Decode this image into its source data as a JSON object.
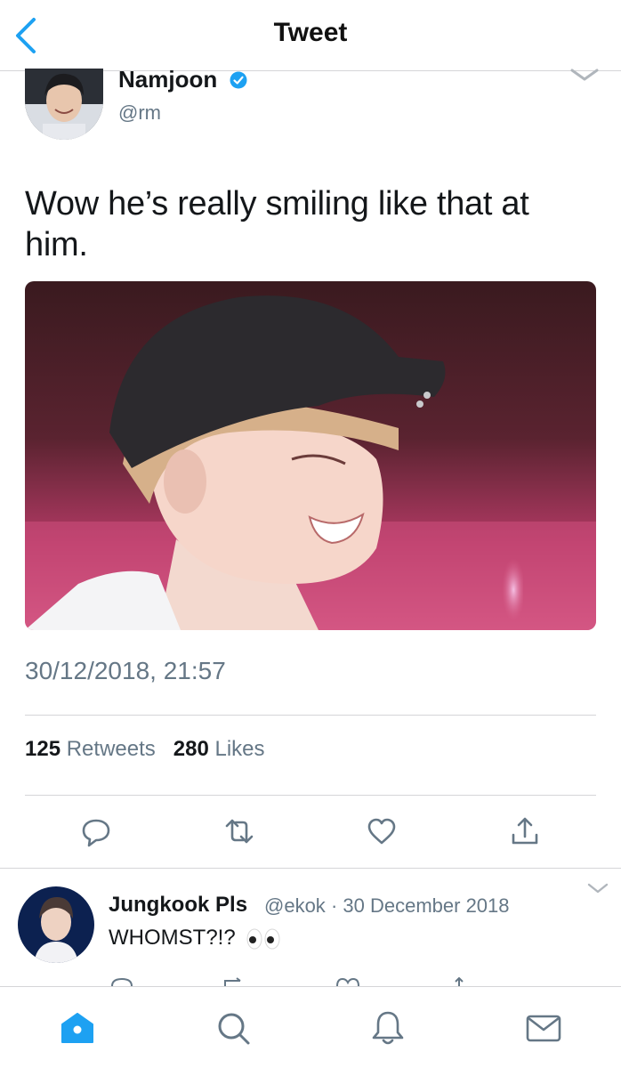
{
  "nav": {
    "title": "Tweet"
  },
  "tweet": {
    "author_name": "Namjoon",
    "author_handle": "@rm",
    "text": "Wow he’s really smiling like that at him.",
    "timestamp": "30/12/2018, 21:57",
    "retweets_count": "125",
    "retweets_label": "Retweets",
    "likes_count": "280",
    "likes_label": "Likes"
  },
  "reply": {
    "author_name": "Jungkook Pls",
    "author_handle": "@ekok",
    "separator": "·",
    "date": "30 December 2018",
    "text": "WHOMST?!?",
    "emoji": "eyes"
  },
  "icons": {
    "back": "chevron-left-icon",
    "verified": "verified-badge-icon",
    "reply": "reply-icon",
    "retweet": "retweet-icon",
    "like": "heart-icon",
    "share": "share-icon",
    "home": "home-icon",
    "search": "search-icon",
    "notifications": "bell-icon",
    "messages": "mail-icon"
  },
  "colors": {
    "accent": "#1da1f2",
    "text": "#14171a",
    "secondary": "#657786",
    "divider": "#d5d5d8"
  }
}
